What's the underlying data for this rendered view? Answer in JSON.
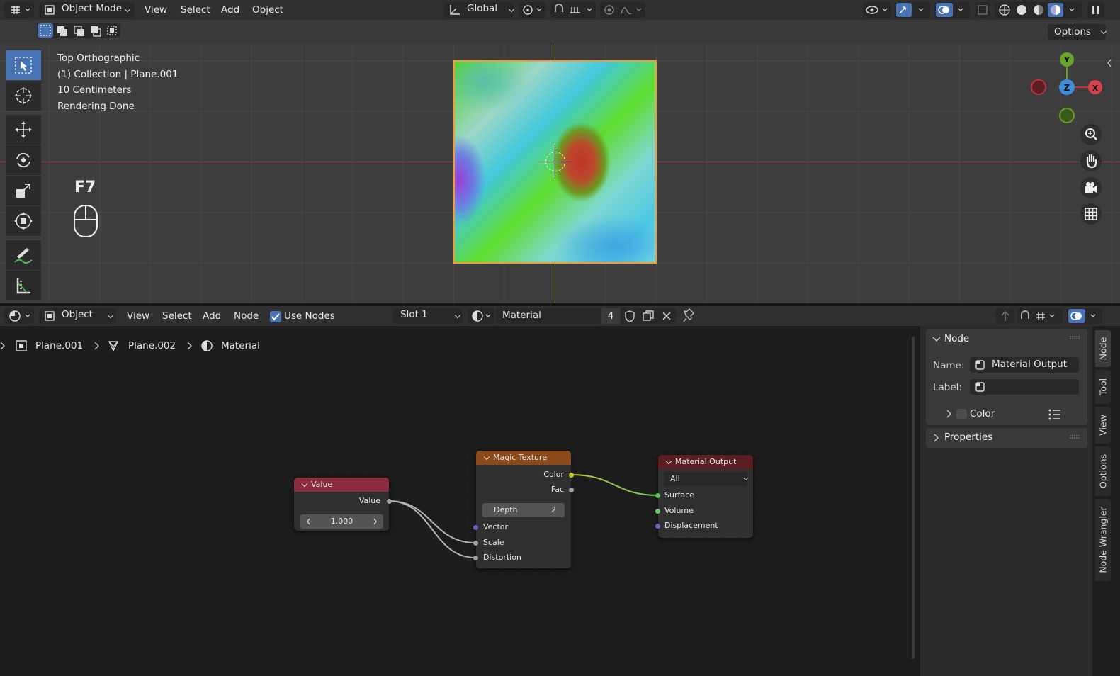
{
  "top_header": {
    "mode": "Object Mode",
    "menus": [
      "View",
      "Select",
      "Add",
      "Object"
    ],
    "transform_orientation": "Global",
    "options_label": "Options"
  },
  "viewport": {
    "view_name": "Top Orthographic",
    "collection": "(1) Collection | Plane.001",
    "scale": "10 Centimeters",
    "status": "Rendering Done",
    "key_hint": "F7",
    "gizmo": {
      "y": "Y",
      "z": "Z",
      "x": "X"
    }
  },
  "node_header": {
    "mode": "Object",
    "menus": [
      "View",
      "Select",
      "Add",
      "Node"
    ],
    "use_nodes_label": "Use Nodes",
    "use_nodes_checked": true,
    "slot": "Slot 1",
    "material_name": "Material",
    "user_count": "4"
  },
  "breadcrumb": {
    "object": "Plane.001",
    "mesh": "Plane.002",
    "material": "Material"
  },
  "nodes": {
    "value": {
      "title": "Value",
      "output": "Value",
      "field": "1.000"
    },
    "magic": {
      "title": "Magic Texture",
      "out_color": "Color",
      "out_fac": "Fac",
      "depth_label": "Depth",
      "depth_value": "2",
      "in_vector": "Vector",
      "in_scale": "Scale",
      "in_distortion": "Distortion"
    },
    "output": {
      "title": "Material Output",
      "target": "All",
      "in_surface": "Surface",
      "in_volume": "Volume",
      "in_displacement": "Displacement"
    }
  },
  "sidebar": {
    "node_panel_title": "Node",
    "name_label": "Name:",
    "name_value": "Material Output",
    "label_label": "Label:",
    "label_value": "",
    "color_label": "Color",
    "properties_title": "Properties",
    "tabs": [
      "Node",
      "Tool",
      "View",
      "Options",
      "Node Wrangler"
    ]
  },
  "colors": {
    "header_bg": "#303030",
    "viewport_bg": "#3d3d3d",
    "node_editor_bg": "#1d1d1d",
    "accent_blue": "#4772b3",
    "selection_orange": "#f39c33",
    "value_node_header": "#8c2c43",
    "texture_node_header": "#8b4a1b",
    "output_node_header": "#5a1e23",
    "socket_yellow": "#c7c729",
    "socket_grey": "#a1a1a1",
    "socket_green": "#63c763",
    "socket_purple": "#6363c7"
  }
}
